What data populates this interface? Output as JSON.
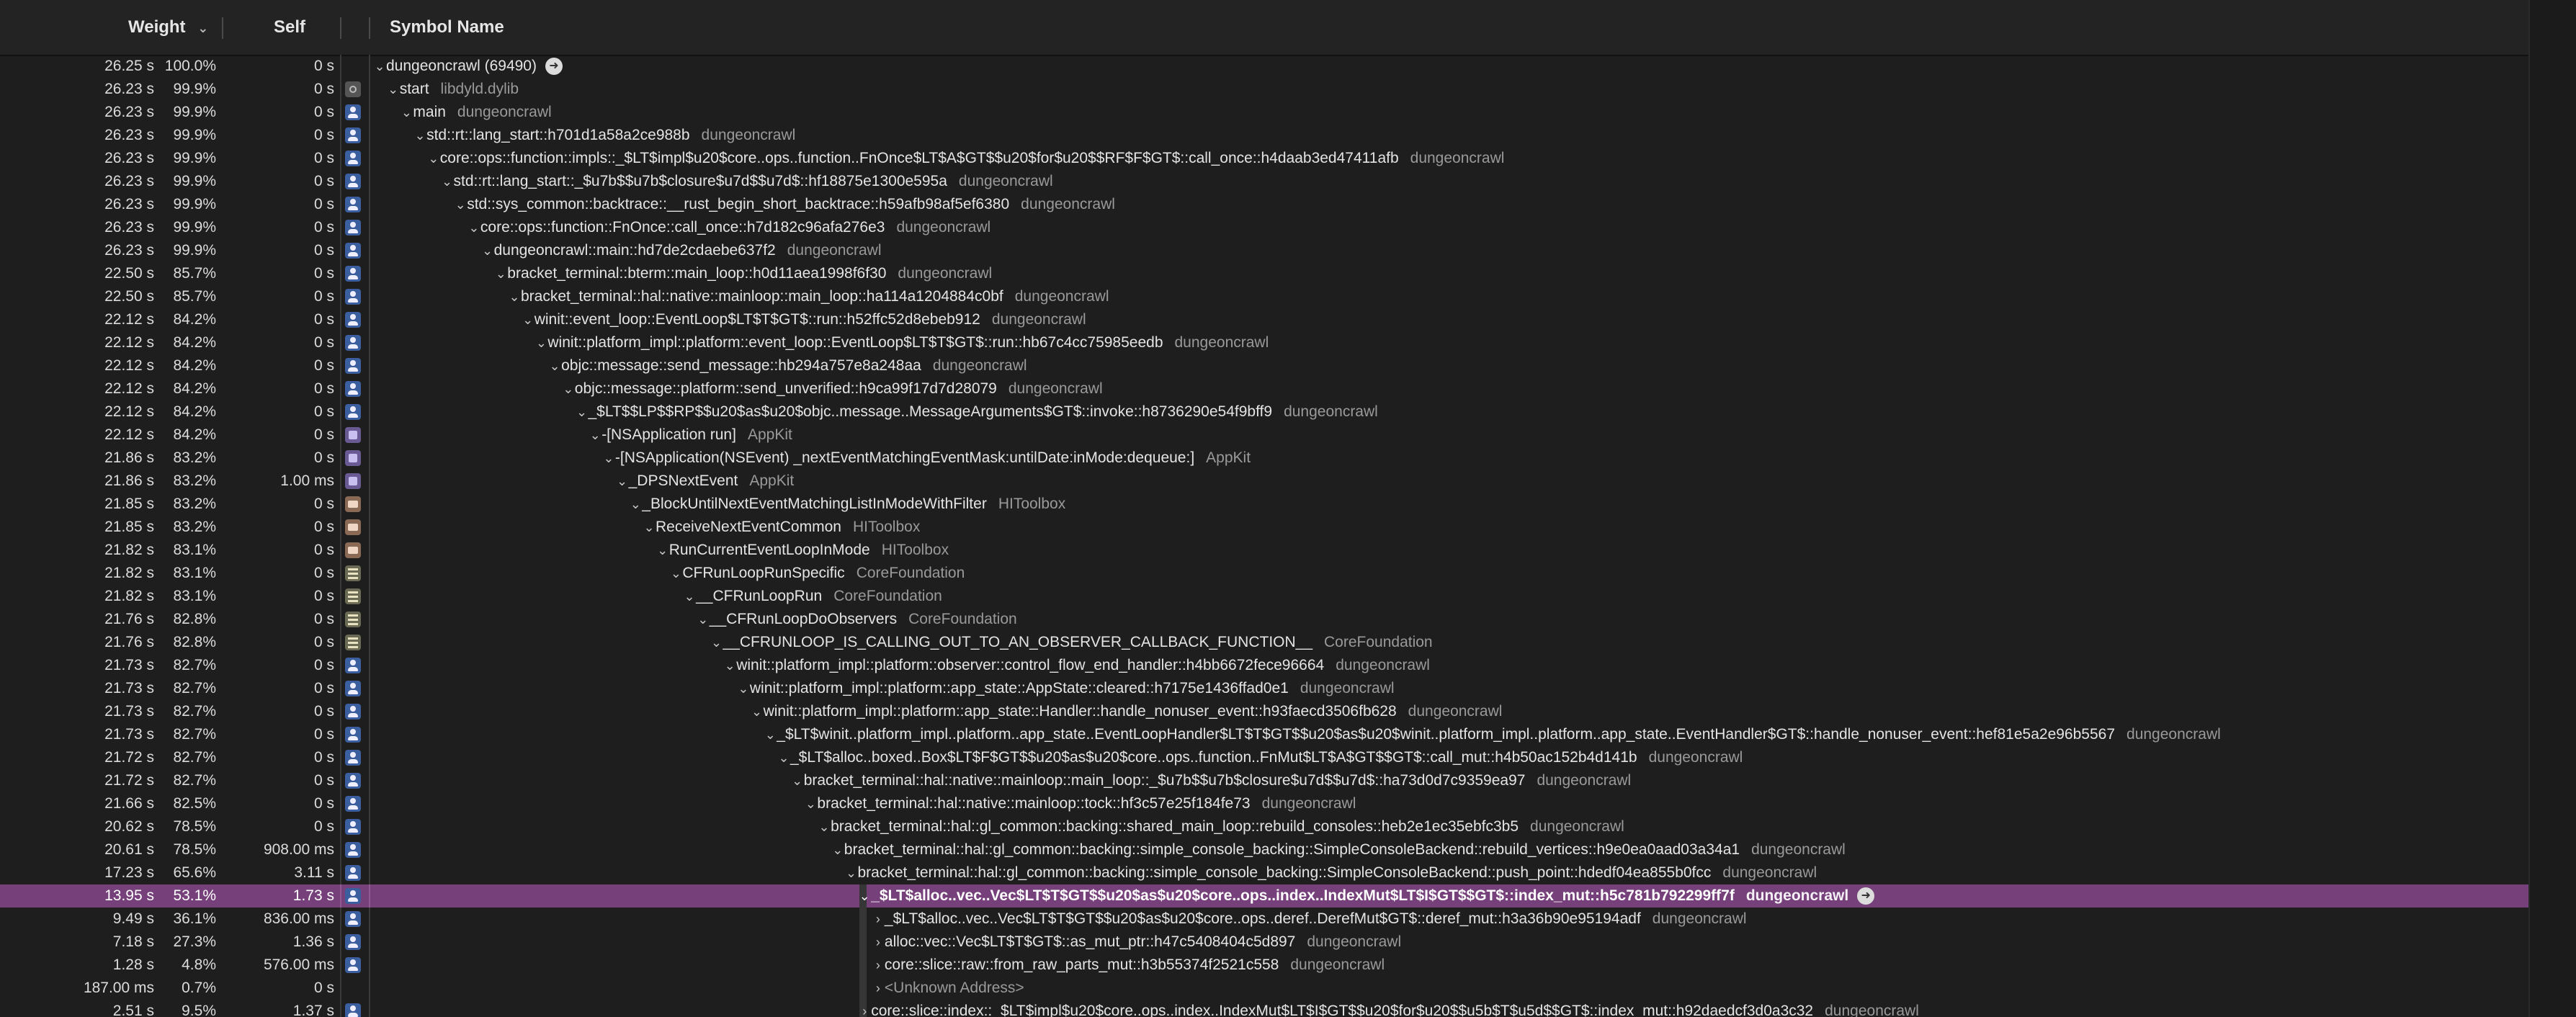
{
  "header": {
    "weight_label": "Weight",
    "self_label": "Self",
    "symbol_label": "Symbol Name"
  },
  "colors": {
    "background": "#1e1e1e",
    "selected_row": "#76407a",
    "library_text": "#9a9a9a"
  },
  "rows": [
    {
      "weight": "26.25 s",
      "percent": "100.0%",
      "self": "0 s",
      "icon": "none",
      "depth": 0,
      "arrow": "down",
      "name": "dungeoncrawl (69490)",
      "lib": "",
      "goto": true
    },
    {
      "weight": "26.23 s",
      "percent": "99.9%",
      "self": "0 s",
      "icon": "dyld",
      "depth": 1,
      "arrow": "down",
      "name": "start",
      "lib": "libdyld.dylib"
    },
    {
      "weight": "26.23 s",
      "percent": "99.9%",
      "self": "0 s",
      "icon": "user",
      "depth": 2,
      "arrow": "down",
      "name": "main",
      "lib": "dungeoncrawl"
    },
    {
      "weight": "26.23 s",
      "percent": "99.9%",
      "self": "0 s",
      "icon": "user",
      "depth": 3,
      "arrow": "down",
      "name": "std::rt::lang_start::h701d1a58a2ce988b",
      "lib": "dungeoncrawl"
    },
    {
      "weight": "26.23 s",
      "percent": "99.9%",
      "self": "0 s",
      "icon": "user",
      "depth": 4,
      "arrow": "down",
      "name": "core::ops::function::impls::_$LT$impl$u20$core..ops..function..FnOnce$LT$A$GT$$u20$for$u20$$RF$F$GT$::call_once::h4daab3ed47411afb",
      "lib": "dungeoncrawl"
    },
    {
      "weight": "26.23 s",
      "percent": "99.9%",
      "self": "0 s",
      "icon": "user",
      "depth": 5,
      "arrow": "down",
      "name": "std::rt::lang_start::_$u7b$$u7b$closure$u7d$$u7d$::hf18875e1300e595a",
      "lib": "dungeoncrawl"
    },
    {
      "weight": "26.23 s",
      "percent": "99.9%",
      "self": "0 s",
      "icon": "user",
      "depth": 6,
      "arrow": "down",
      "name": "std::sys_common::backtrace::__rust_begin_short_backtrace::h59afb98af5ef6380",
      "lib": "dungeoncrawl"
    },
    {
      "weight": "26.23 s",
      "percent": "99.9%",
      "self": "0 s",
      "icon": "user",
      "depth": 7,
      "arrow": "down",
      "name": "core::ops::function::FnOnce::call_once::h7d182c96afa276e3",
      "lib": "dungeoncrawl"
    },
    {
      "weight": "26.23 s",
      "percent": "99.9%",
      "self": "0 s",
      "icon": "user",
      "depth": 8,
      "arrow": "down",
      "name": "dungeoncrawl::main::hd7de2cdaebe637f2",
      "lib": "dungeoncrawl"
    },
    {
      "weight": "22.50 s",
      "percent": "85.7%",
      "self": "0 s",
      "icon": "user",
      "depth": 9,
      "arrow": "down",
      "name": "bracket_terminal::bterm::main_loop::h0d11aea1998f6f30",
      "lib": "dungeoncrawl"
    },
    {
      "weight": "22.50 s",
      "percent": "85.7%",
      "self": "0 s",
      "icon": "user",
      "depth": 10,
      "arrow": "down",
      "name": "bracket_terminal::hal::native::mainloop::main_loop::ha114a1204884c0bf",
      "lib": "dungeoncrawl"
    },
    {
      "weight": "22.12 s",
      "percent": "84.2%",
      "self": "0 s",
      "icon": "user",
      "depth": 11,
      "arrow": "down",
      "name": "winit::event_loop::EventLoop$LT$T$GT$::run::h52ffc52d8ebeb912",
      "lib": "dungeoncrawl"
    },
    {
      "weight": "22.12 s",
      "percent": "84.2%",
      "self": "0 s",
      "icon": "user",
      "depth": 12,
      "arrow": "down",
      "name": "winit::platform_impl::platform::event_loop::EventLoop$LT$T$GT$::run::hb67c4cc75985eedb",
      "lib": "dungeoncrawl"
    },
    {
      "weight": "22.12 s",
      "percent": "84.2%",
      "self": "0 s",
      "icon": "user",
      "depth": 13,
      "arrow": "down",
      "name": "objc::message::send_message::hb294a757e8a248aa",
      "lib": "dungeoncrawl"
    },
    {
      "weight": "22.12 s",
      "percent": "84.2%",
      "self": "0 s",
      "icon": "user",
      "depth": 14,
      "arrow": "down",
      "name": "objc::message::platform::send_unverified::h9ca99f17d7d28079",
      "lib": "dungeoncrawl"
    },
    {
      "weight": "22.12 s",
      "percent": "84.2%",
      "self": "0 s",
      "icon": "user",
      "depth": 15,
      "arrow": "down",
      "name": "_$LT$$LP$$RP$$u20$as$u20$objc..message..MessageArguments$GT$::invoke::h8736290e54f9bff9",
      "lib": "dungeoncrawl"
    },
    {
      "weight": "22.12 s",
      "percent": "84.2%",
      "self": "0 s",
      "icon": "kit",
      "depth": 16,
      "arrow": "down",
      "name": "-[NSApplication run]",
      "lib": "AppKit"
    },
    {
      "weight": "21.86 s",
      "percent": "83.2%",
      "self": "0 s",
      "icon": "kit",
      "depth": 17,
      "arrow": "down",
      "name": "-[NSApplication(NSEvent) _nextEventMatchingEventMask:untilDate:inMode:dequeue:]",
      "lib": "AppKit"
    },
    {
      "weight": "21.86 s",
      "percent": "83.2%",
      "self": "1.00 ms",
      "icon": "kit",
      "depth": 18,
      "arrow": "down",
      "name": "_DPSNextEvent",
      "lib": "AppKit"
    },
    {
      "weight": "21.85 s",
      "percent": "83.2%",
      "self": "0 s",
      "icon": "tool",
      "depth": 19,
      "arrow": "down",
      "name": "_BlockUntilNextEventMatchingListInModeWithFilter",
      "lib": "HIToolbox"
    },
    {
      "weight": "21.85 s",
      "percent": "83.2%",
      "self": "0 s",
      "icon": "tool",
      "depth": 20,
      "arrow": "down",
      "name": "ReceiveNextEventCommon",
      "lib": "HIToolbox"
    },
    {
      "weight": "21.82 s",
      "percent": "83.1%",
      "self": "0 s",
      "icon": "tool",
      "depth": 21,
      "arrow": "down",
      "name": "RunCurrentEventLoopInMode",
      "lib": "HIToolbox"
    },
    {
      "weight": "21.82 s",
      "percent": "83.1%",
      "self": "0 s",
      "icon": "found",
      "depth": 22,
      "arrow": "down",
      "name": "CFRunLoopRunSpecific",
      "lib": "CoreFoundation"
    },
    {
      "weight": "21.82 s",
      "percent": "83.1%",
      "self": "0 s",
      "icon": "found",
      "depth": 23,
      "arrow": "down",
      "name": "__CFRunLoopRun",
      "lib": "CoreFoundation"
    },
    {
      "weight": "21.76 s",
      "percent": "82.8%",
      "self": "0 s",
      "icon": "found",
      "depth": 24,
      "arrow": "down",
      "name": "__CFRunLoopDoObservers",
      "lib": "CoreFoundation"
    },
    {
      "weight": "21.76 s",
      "percent": "82.8%",
      "self": "0 s",
      "icon": "found",
      "depth": 25,
      "arrow": "down",
      "name": "__CFRUNLOOP_IS_CALLING_OUT_TO_AN_OBSERVER_CALLBACK_FUNCTION__",
      "lib": "CoreFoundation"
    },
    {
      "weight": "21.73 s",
      "percent": "82.7%",
      "self": "0 s",
      "icon": "user",
      "depth": 26,
      "arrow": "down",
      "name": "winit::platform_impl::platform::observer::control_flow_end_handler::h4bb6672fece96664",
      "lib": "dungeoncrawl"
    },
    {
      "weight": "21.73 s",
      "percent": "82.7%",
      "self": "0 s",
      "icon": "user",
      "depth": 27,
      "arrow": "down",
      "name": "winit::platform_impl::platform::app_state::AppState::cleared::h7175e1436ffad0e1",
      "lib": "dungeoncrawl"
    },
    {
      "weight": "21.73 s",
      "percent": "82.7%",
      "self": "0 s",
      "icon": "user",
      "depth": 28,
      "arrow": "down",
      "name": "winit::platform_impl::platform::app_state::Handler::handle_nonuser_event::h93faecd3506fb628",
      "lib": "dungeoncrawl"
    },
    {
      "weight": "21.73 s",
      "percent": "82.7%",
      "self": "0 s",
      "icon": "user",
      "depth": 29,
      "arrow": "down",
      "name": "_$LT$winit..platform_impl..platform..app_state..EventLoopHandler$LT$T$GT$$u20$as$u20$winit..platform_impl..platform..app_state..EventHandler$GT$::handle_nonuser_event::hef81e5a2e96b5567",
      "lib": "dungeoncrawl"
    },
    {
      "weight": "21.72 s",
      "percent": "82.7%",
      "self": "0 s",
      "icon": "user",
      "depth": 30,
      "arrow": "down",
      "name": "_$LT$alloc..boxed..Box$LT$F$GT$$u20$as$u20$core..ops..function..FnMut$LT$A$GT$$GT$::call_mut::h4b50ac152b4d141b",
      "lib": "dungeoncrawl"
    },
    {
      "weight": "21.72 s",
      "percent": "82.7%",
      "self": "0 s",
      "icon": "user",
      "depth": 31,
      "arrow": "down",
      "name": "bracket_terminal::hal::native::mainloop::main_loop::_$u7b$$u7b$closure$u7d$$u7d$::ha73d0d7c9359ea97",
      "lib": "dungeoncrawl"
    },
    {
      "weight": "21.66 s",
      "percent": "82.5%",
      "self": "0 s",
      "icon": "user",
      "depth": 32,
      "arrow": "down",
      "name": "bracket_terminal::hal::native::mainloop::tock::hf3c57e25f184fe73",
      "lib": "dungeoncrawl"
    },
    {
      "weight": "20.62 s",
      "percent": "78.5%",
      "self": "0 s",
      "icon": "user",
      "depth": 33,
      "arrow": "down",
      "name": "bracket_terminal::hal::gl_common::backing::shared_main_loop::rebuild_consoles::heb2e1ec35ebfc3b5",
      "lib": "dungeoncrawl"
    },
    {
      "weight": "20.61 s",
      "percent": "78.5%",
      "self": "908.00 ms",
      "icon": "user",
      "depth": 34,
      "arrow": "down",
      "name": "bracket_terminal::hal::gl_common::backing::simple_console_backing::SimpleConsoleBackend::rebuild_vertices::h9e0ea0aad03a34a1",
      "lib": "dungeoncrawl"
    },
    {
      "weight": "17.23 s",
      "percent": "65.6%",
      "self": "3.11 s",
      "icon": "user",
      "depth": 35,
      "arrow": "down",
      "name": "bracket_terminal::hal::gl_common::backing::simple_console_backing::SimpleConsoleBackend::push_point::hdedf04ea855b0fcc",
      "lib": "dungeoncrawl"
    },
    {
      "weight": "13.95 s",
      "percent": "53.1%",
      "self": "1.73 s",
      "icon": "user",
      "depth": 36,
      "arrow": "down",
      "name": "_$LT$alloc..vec..Vec$LT$T$GT$$u20$as$u20$core..ops..index..IndexMut$LT$I$GT$$GT$::index_mut::h5c781b792299ff7f",
      "lib": "dungeoncrawl",
      "selected": true,
      "goto": true
    },
    {
      "weight": "9.49 s",
      "percent": "36.1%",
      "self": "836.00 ms",
      "icon": "user",
      "depth": 37,
      "arrow": "right",
      "name": "_$LT$alloc..vec..Vec$LT$T$GT$$u20$as$u20$core..ops..deref..DerefMut$GT$::deref_mut::h3a36b90e95194adf",
      "lib": "dungeoncrawl"
    },
    {
      "weight": "7.18 s",
      "percent": "27.3%",
      "self": "1.36 s",
      "icon": "user",
      "depth": 37,
      "arrow": "right",
      "name": "alloc::vec::Vec$LT$T$GT$::as_mut_ptr::h47c5408404c5d897",
      "lib": "dungeoncrawl"
    },
    {
      "weight": "1.28 s",
      "percent": "4.8%",
      "self": "576.00 ms",
      "icon": "user",
      "depth": 37,
      "arrow": "right",
      "name": "core::slice::raw::from_raw_parts_mut::h3b55374f2521c558",
      "lib": "dungeoncrawl"
    },
    {
      "weight": "187.00 ms",
      "percent": "0.7%",
      "self": "0 s",
      "icon": "none",
      "depth": 37,
      "arrow": "right",
      "name": "<Unknown Address>",
      "lib": "",
      "unknown": true
    },
    {
      "weight": "2.51 s",
      "percent": "9.5%",
      "self": "1.37 s",
      "icon": "user",
      "depth": 36,
      "arrow": "right",
      "name": "core::slice::index::_$LT$impl$u20$core..ops..index..IndexMut$LT$I$GT$$u20$for$u20$$u5b$T$u5d$$GT$::index_mut::h92daedcf3d0a3c32",
      "lib": "dungeoncrawl"
    }
  ]
}
